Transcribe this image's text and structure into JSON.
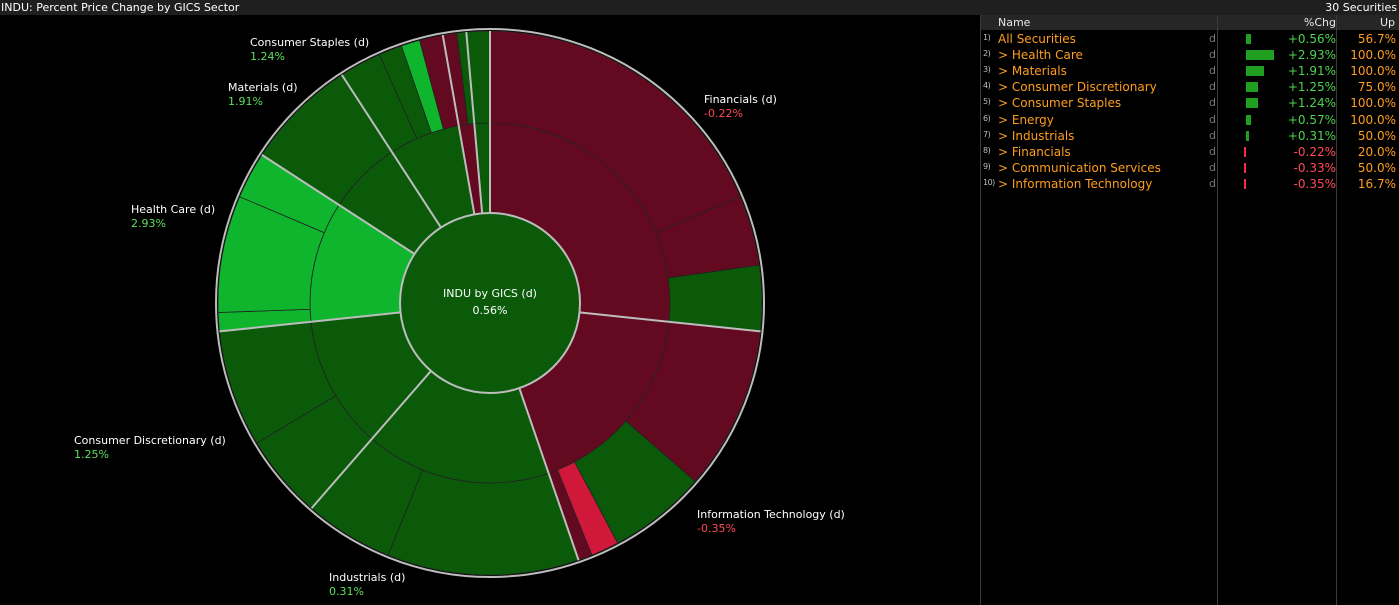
{
  "header": {
    "title": "INDU: Percent Price Change by GICS Sector",
    "securities": "30 Securities"
  },
  "center": {
    "label": "INDU by GICS (d)",
    "value": "0.56%"
  },
  "labels": [
    {
      "name": "Financials (d)",
      "value": "-0.22%"
    },
    {
      "name": "Information Technology (d)",
      "value": "-0.35%"
    },
    {
      "name": "Industrials (d)",
      "value": "0.31%"
    },
    {
      "name": "Consumer Discretionary (d)",
      "value": "1.25%"
    },
    {
      "name": "Health Care (d)",
      "value": "2.93%"
    },
    {
      "name": "Materials (d)",
      "value": "1.91%"
    },
    {
      "name": "Consumer Staples (d)",
      "value": "1.24%"
    }
  ],
  "colors": {
    "pos_dark": "#0a5a0a",
    "pos_light": "#10b52e",
    "neg_dark": "#630a20",
    "neg_light": "#d0183a",
    "name_orange": "#ff9e1f"
  },
  "table": {
    "columns": {
      "name": "Name",
      "pct": "%Chg",
      "up": "Up"
    },
    "rows": [
      {
        "num": "1)",
        "name": "All Securities",
        "d": "d",
        "pct": "+0.56%",
        "value": 0.56,
        "up": "56.7%"
      },
      {
        "num": "2)",
        "name": "> Health Care",
        "d": "d",
        "pct": "+2.93%",
        "value": 2.93,
        "up": "100.0%"
      },
      {
        "num": "3)",
        "name": "> Materials",
        "d": "d",
        "pct": "+1.91%",
        "value": 1.91,
        "up": "100.0%"
      },
      {
        "num": "4)",
        "name": "> Consumer Discretionary",
        "d": "d",
        "pct": "+1.25%",
        "value": 1.25,
        "up": "75.0%"
      },
      {
        "num": "5)",
        "name": "> Consumer Staples",
        "d": "d",
        "pct": "+1.24%",
        "value": 1.24,
        "up": "100.0%"
      },
      {
        "num": "6)",
        "name": "> Energy",
        "d": "d",
        "pct": "+0.57%",
        "value": 0.57,
        "up": "100.0%"
      },
      {
        "num": "7)",
        "name": "> Industrials",
        "d": "d",
        "pct": "+0.31%",
        "value": 0.31,
        "up": "50.0%"
      },
      {
        "num": "8)",
        "name": "> Financials",
        "d": "d",
        "pct": "-0.22%",
        "value": -0.22,
        "up": "20.0%"
      },
      {
        "num": "9)",
        "name": "> Communication Services",
        "d": "d",
        "pct": "-0.33%",
        "value": -0.33,
        "up": "50.0%"
      },
      {
        "num": "10)",
        "name": "> Information Technology",
        "d": "d",
        "pct": "-0.35%",
        "value": -0.35,
        "up": "16.7%"
      }
    ]
  }
}
